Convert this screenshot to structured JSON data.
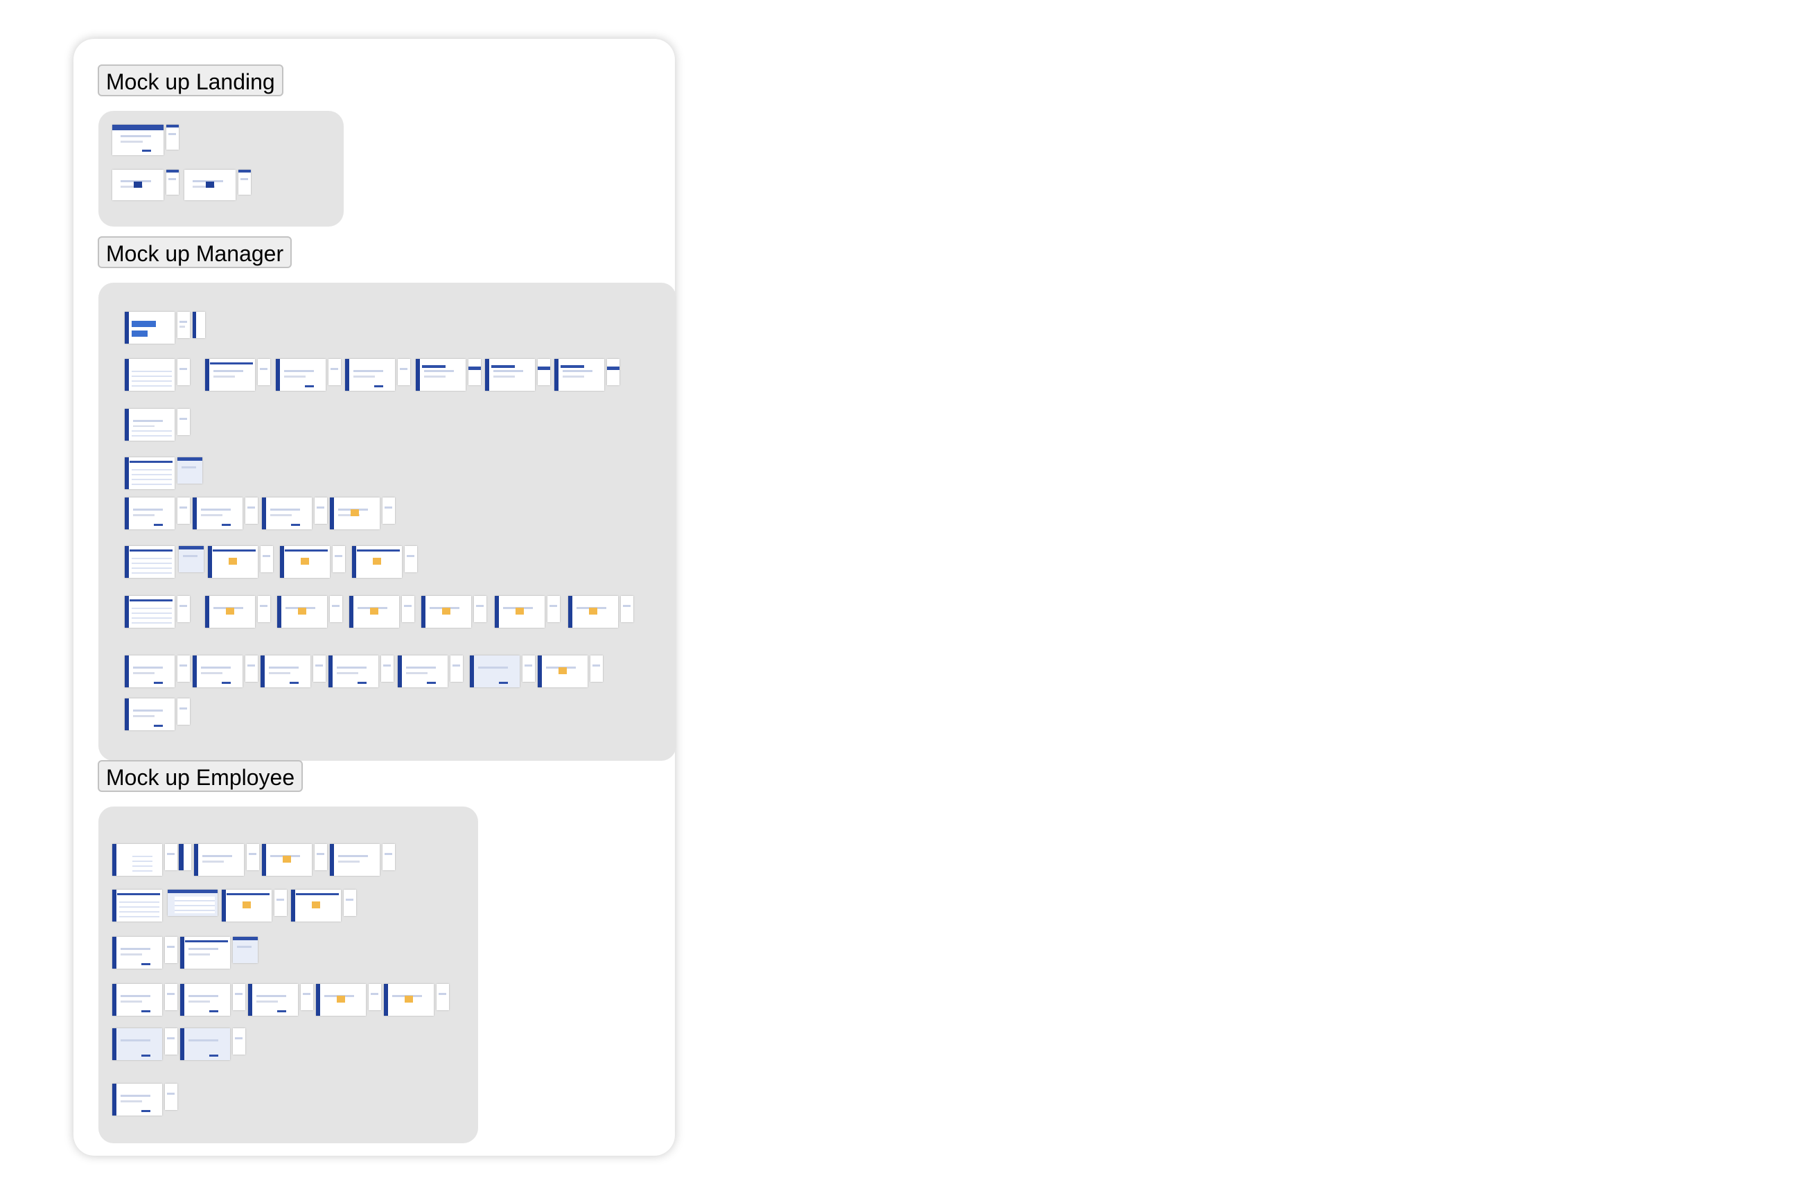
{
  "sections": {
    "landing": {
      "label": "Mock up Landing"
    },
    "manager": {
      "label": "Mock up Manager"
    },
    "employee": {
      "label": "Mock up Employee"
    }
  },
  "colors": {
    "page_background": "#ffffff",
    "panel_background": "#e4e4e4",
    "frame_primary": "#1f3f97",
    "frame_accent": "#f3b84a"
  }
}
